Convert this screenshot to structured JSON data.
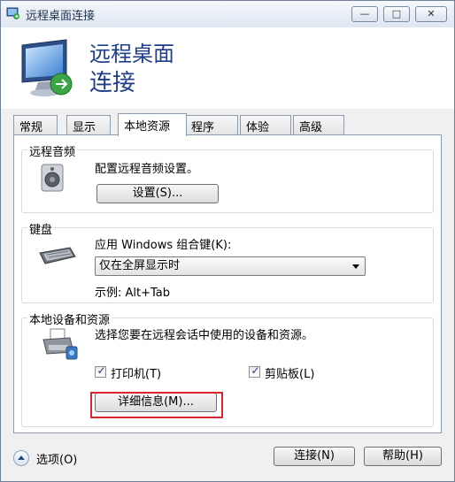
{
  "window": {
    "title": "远程桌面连接",
    "header_line1": "远程桌面",
    "header_line2": "连接",
    "controls": {
      "minimize": "—",
      "maximize": "□",
      "close": "✕"
    }
  },
  "tabs": [
    {
      "label": "常规"
    },
    {
      "label": "显示"
    },
    {
      "label": "本地资源",
      "active": true
    },
    {
      "label": "程序"
    },
    {
      "label": "体验"
    },
    {
      "label": "高级"
    }
  ],
  "audio": {
    "group_title": "远程音频",
    "description": "配置远程音频设置。",
    "settings_button": "设置(S)..."
  },
  "keyboard": {
    "group_title": "键盘",
    "description": "应用 Windows 组合键(K):",
    "selected_option": "仅在全屏显示时",
    "example": "示例: Alt+Tab"
  },
  "devices": {
    "group_title": "本地设备和资源",
    "description": "选择您要在远程会话中使用的设备和资源。",
    "printers_label": "打印机(T)",
    "printers_checked": true,
    "clipboard_label": "剪贴板(L)",
    "clipboard_checked": true,
    "details_button": "详细信息(M)..."
  },
  "footer": {
    "options_label": "选项(O)",
    "connect_button": "连接(N)",
    "help_button": "帮助(H)"
  },
  "colors": {
    "header_text": "#1f3d8a",
    "highlight_border": "#d9262c"
  }
}
